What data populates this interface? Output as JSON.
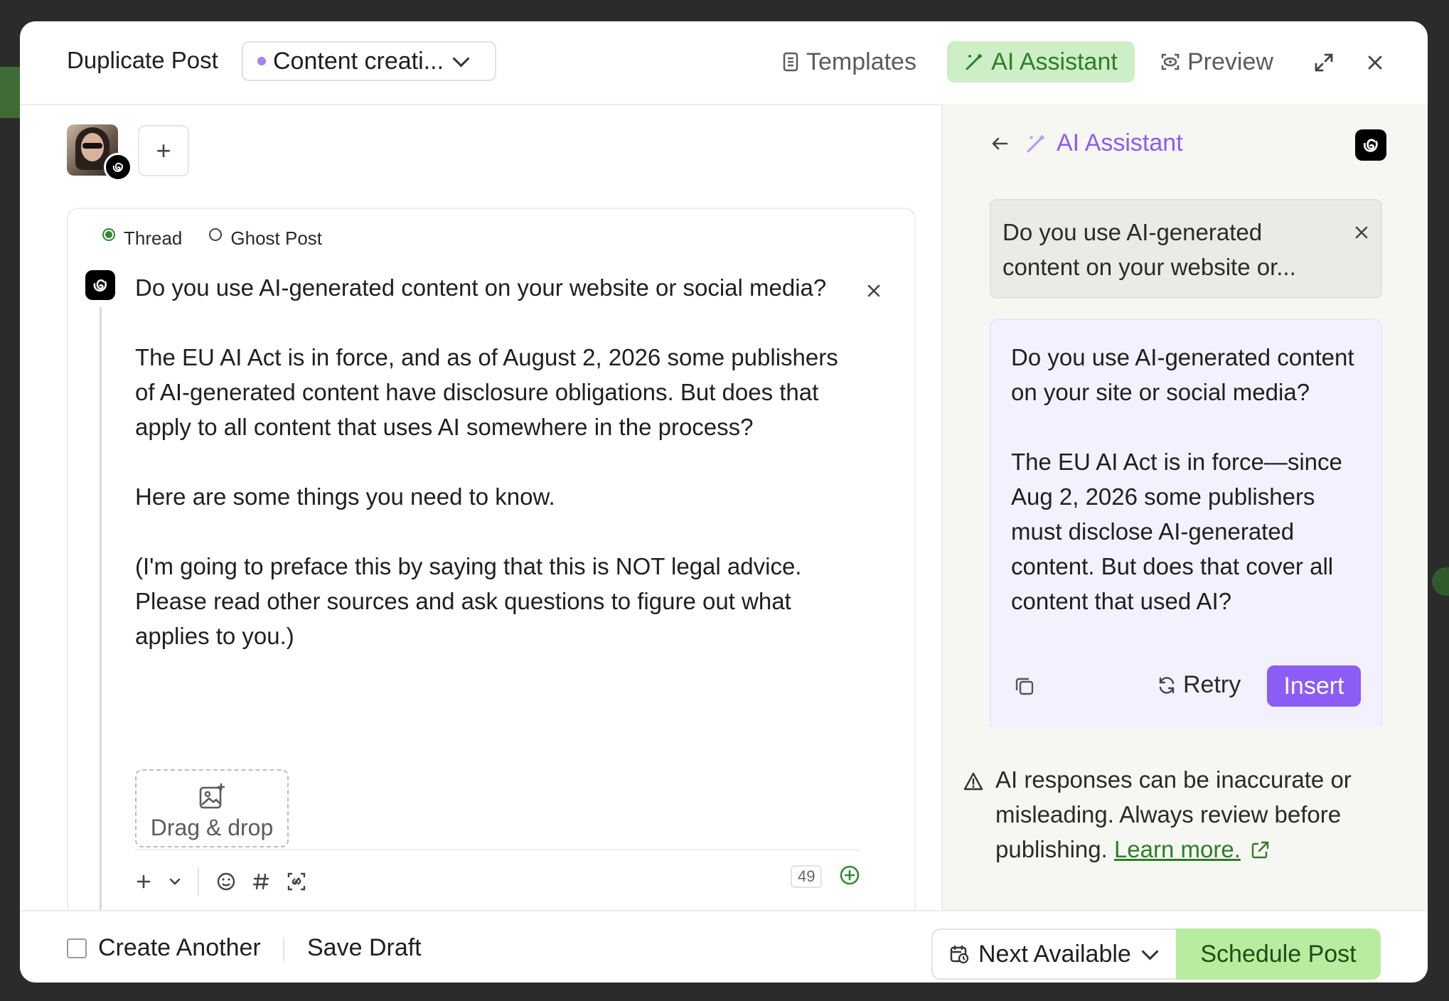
{
  "header": {
    "title": "Duplicate Post",
    "group_label": "Content creati...",
    "templates_label": "Templates",
    "ai_assistant_label": "AI Assistant",
    "preview_label": "Preview"
  },
  "editor": {
    "radio_thread": "Thread",
    "radio_ghost": "Ghost Post",
    "selected_mode": "Thread",
    "post_text": "Do you use AI-generated content on your website or social media?\n\nThe EU AI Act is in force, and as of August 2, 2026 some publishers of AI-generated content have disclosure obligations. But does that apply to all content that uses AI somewhere in the process?\n\nHere are some things you need to know.\n\n(I'm going to preface this by saying that this is NOT legal advice. Please read other sources and ask questions to figure out what applies to you.)",
    "dropzone_label": "Drag & drop",
    "char_count": "49"
  },
  "ai_panel": {
    "title": "AI Assistant",
    "prompt": "Do you use AI-generated content on your website or...",
    "response": "Do you use AI-generated content on your site or social media?\n\nThe EU AI Act is in force—since Aug 2, 2026 some publishers must disclose AI-generated content. But does that cover all content that used AI?",
    "retry_label": "Retry",
    "insert_label": "Insert",
    "disclaimer": "AI responses can be inaccurate or misleading. Always review before publishing.",
    "learn_more": "Learn more."
  },
  "footer": {
    "create_another": "Create Another",
    "save_draft": "Save Draft",
    "next_available": "Next Available",
    "schedule_post": "Schedule Post"
  },
  "colors": {
    "accent_green": "#2e7d27",
    "ai_purple": "#8b5cf6",
    "schedule_green": "#b8ec9e"
  }
}
